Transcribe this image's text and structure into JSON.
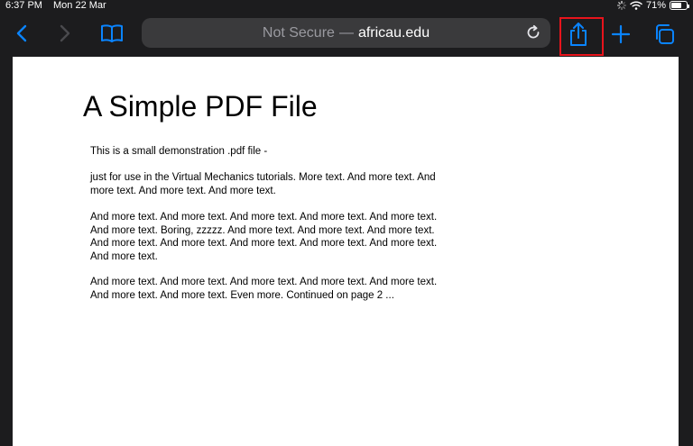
{
  "status_bar": {
    "time": "6:37 PM",
    "date": "Mon 22 Mar",
    "battery": "71%",
    "battery_level": 0.71
  },
  "toolbar": {
    "address_not_secure": "Not Secure",
    "address_separator": "—",
    "address_host": "africau.edu",
    "icons": {
      "back": "chevron-left-icon",
      "forward": "chevron-right-icon",
      "bookmarks": "book-icon",
      "reload": "reload-icon",
      "share": "share-icon",
      "new_tab": "plus-icon",
      "tabs": "tabs-icon"
    },
    "accent_color": "#0a84ff",
    "highlight_color": "#e8141c"
  },
  "document": {
    "title": "A Simple PDF File",
    "paragraphs": [
      "This is a small demonstration .pdf file -",
      "just for use in the Virtual Mechanics tutorials. More text. And more text. And more text. And more text. And more text.",
      "And more text. And more text. And more text. And more text. And more text. And more text. Boring, zzzzz. And more text. And more text. And more text. And more text. And more text. And more text. And more text. And more text. And more text.",
      "And more text. And more text. And more text. And more text. And more text. And more text. And more text. Even more. Continued on page 2 ..."
    ]
  }
}
